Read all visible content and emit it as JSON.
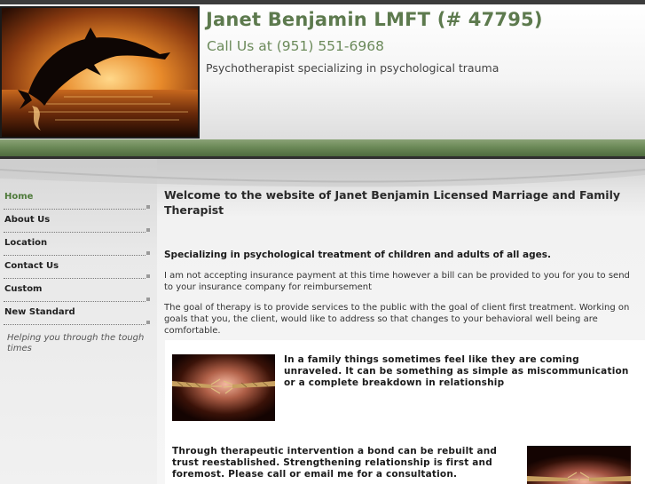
{
  "header": {
    "title": "Janet Benjamin LMFT (# 47795)",
    "phone": "Call Us at (951) 551-6968",
    "tagline": "Psychotherapist specializing in psychological trauma",
    "photo_icon": "dolphin-sunset-photo"
  },
  "nav": {
    "items": [
      {
        "label": "Home",
        "active": true
      },
      {
        "label": "About Us",
        "active": false
      },
      {
        "label": "Location",
        "active": false
      },
      {
        "label": "Contact Us",
        "active": false
      },
      {
        "label": "Custom",
        "active": false
      },
      {
        "label": "New Standard",
        "active": false
      }
    ],
    "note": "Helping you through the tough times"
  },
  "main": {
    "welcome": "Welcome to the website of Janet Benjamin Licensed Marriage and Family Therapist",
    "specializing": "Specializing in psychological treatment of children and adults of all ages.",
    "insurance": "I am not accepting insurance payment at this time however a bill can be provided to you for you to send to your insurance company for reimbursement",
    "goal": "The goal of therapy is to provide services to the public with the goal of client first treatment.  Working on goals that you, the client, would like to address so that changes to your behavioral well being are comfortable.",
    "family": "In a family things sometimes feel like they are coming unraveled. It can be something as simple as miscommunication or a complete breakdown in relationship",
    "bond": "Through therapeutic intervention a bond can be rebuilt and trust reestablished.  Strengthening relationship is first and foremost.  Please call or email me for a consultation."
  },
  "colors": {
    "title_green": "#5d7a4e",
    "band_green": "#6c8a58",
    "active_nav": "#4e7a3a"
  }
}
